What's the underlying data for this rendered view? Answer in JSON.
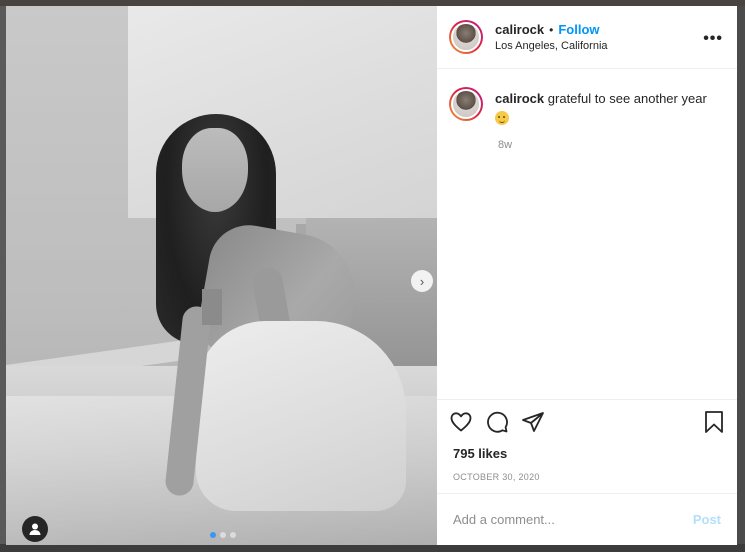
{
  "post": {
    "username": "calirock",
    "separator": "•",
    "follow_label": "Follow",
    "location": "Los Angeles, California",
    "more_label": "•••",
    "caption_username": "calirock",
    "caption_text": "grateful to see another year",
    "caption_emoji": "smiling-face-emoji",
    "time_ago": "8w",
    "likes": "795 likes",
    "date": "OCTOBER 30, 2020",
    "comment_placeholder": "Add a comment...",
    "post_label": "Post",
    "next_label": "›"
  },
  "media": {
    "carousel_total": 3,
    "carousel_active": 1
  },
  "colors": {
    "follow": "#0095f6",
    "post_disabled": "#b2dffc",
    "muted": "#8e8e8e",
    "active_dot": "#3897f0"
  },
  "icons": [
    "like-heart-icon",
    "comment-icon",
    "share-icon",
    "bookmark-icon",
    "more-options-icon",
    "user-tag-icon",
    "next-arrow-icon"
  ]
}
